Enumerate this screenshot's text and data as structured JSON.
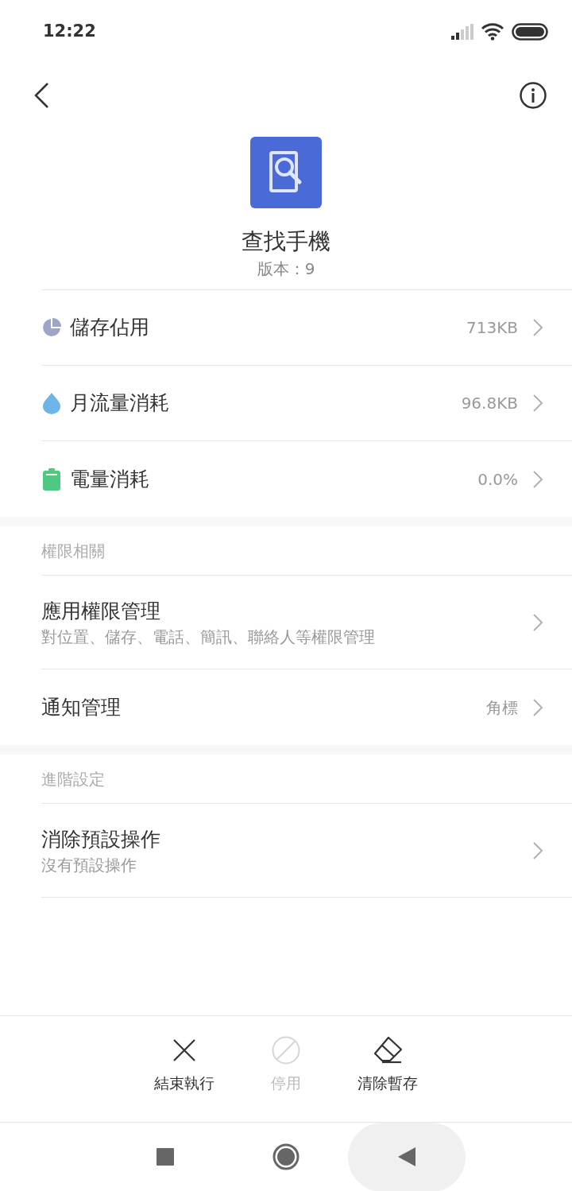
{
  "status_bar": {
    "time": "12:22"
  },
  "app": {
    "name": "查找手機",
    "version": "版本：9"
  },
  "usage": [
    {
      "kind": "storage",
      "label": "儲存佔用",
      "value": "713KB"
    },
    {
      "kind": "data",
      "label": "月流量消耗",
      "value": "96.8KB"
    },
    {
      "kind": "battery",
      "label": "電量消耗",
      "value": "0.0%"
    }
  ],
  "sections": [
    {
      "title": "權限相關",
      "items": [
        {
          "label": "應用權限管理",
          "subtitle": "對位置、儲存、電話、簡訊、聯絡人等權限管理"
        },
        {
          "label": "通知管理",
          "value": "角標"
        }
      ]
    },
    {
      "title": "進階設定",
      "items": [
        {
          "label": "消除預設操作",
          "subtitle": "沒有預設操作"
        }
      ]
    }
  ],
  "actions": [
    {
      "kind": "stop",
      "label": "結束執行",
      "disabled": false
    },
    {
      "kind": "disable",
      "label": "停用",
      "disabled": true
    },
    {
      "kind": "clear",
      "label": "清除暫存",
      "disabled": false
    }
  ],
  "nav_buttons": [
    {
      "kind": "recents",
      "pressed": false
    },
    {
      "kind": "home",
      "pressed": false
    },
    {
      "kind": "back",
      "pressed": true
    }
  ]
}
